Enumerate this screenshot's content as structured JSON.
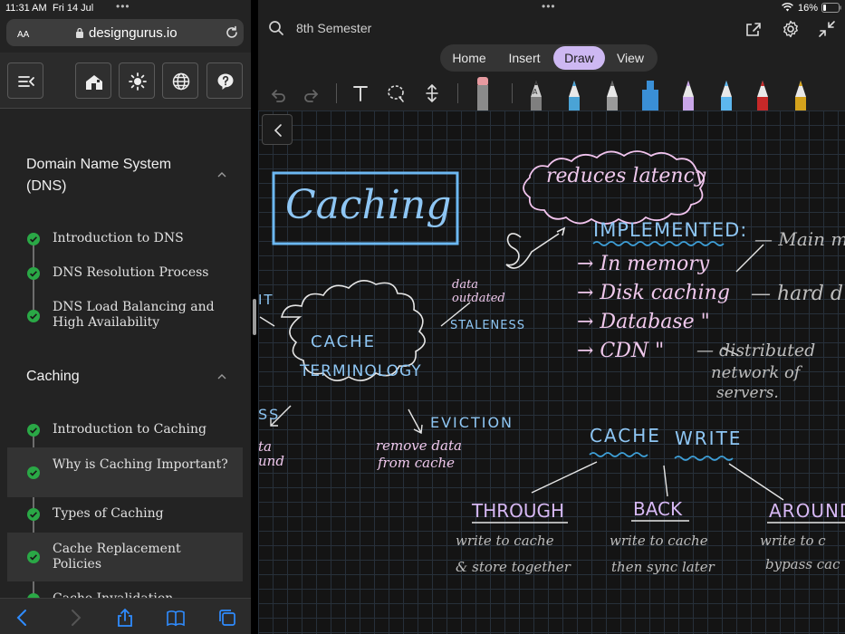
{
  "status_left": {
    "time": "11:31 AM",
    "date": "Fri 14 Jul"
  },
  "safari": {
    "text_size_label": "AA",
    "url": "designgurus.io"
  },
  "course": {
    "sections": [
      {
        "title": "Domain Name System (DNS)",
        "lessons": [
          "Introduction to DNS",
          "DNS Resolution Process",
          "DNS Load Balancing and High Availability"
        ]
      },
      {
        "title": "Caching",
        "lessons": [
          "Introduction to Caching",
          "Why is Caching Important?",
          "Types of Caching",
          "Cache Replacement Policies",
          "Cache Invalidation"
        ]
      }
    ]
  },
  "status_right": {
    "battery": "16%"
  },
  "notes": {
    "document_title": "8th Semester",
    "tabs": [
      "Home",
      "Insert",
      "Draw",
      "View"
    ],
    "active_tab": "Draw"
  },
  "board": {
    "title": "Caching",
    "cloud_top": "reduces latency",
    "cloud_center_1": "CACHE",
    "cloud_center_2": "TERMINOLOGY",
    "implemented": "IMPLEMENTED:",
    "impl_items": [
      "→ In memory",
      "→ Disk caching",
      "→ Database  \"",
      "→ CDN    \""
    ],
    "main_mem": "— Main m",
    "hard_d": "— hard d",
    "distributed": "— distributed",
    "network_of": "network of",
    "servers": "servers.",
    "data_outdated_1": "data",
    "data_outdated_2": "outdated",
    "staleness": "STALENESS",
    "eviction": "EVICTION",
    "remove_1": "remove data",
    "remove_2": "from cache",
    "it_fragment": "IT",
    "ss_fragment": "SS",
    "ta_fragment": "ta",
    "und_fragment": "und",
    "cache_write_1": "CACHE",
    "cache_write_2": "WRITE",
    "through": "THROUGH",
    "back": "BACK",
    "around": "AROUND",
    "through_1": "write to cache",
    "through_2": "& store together",
    "back_1": "write to cache",
    "back_2": "then sync later",
    "around_1": "write to c",
    "around_2": "bypass cac"
  },
  "colors": {
    "active_tab": "#cdb8f2",
    "check_green": "#2aa846",
    "ink_blue": "#8ec6f4",
    "ink_pink": "#efc8ec",
    "ink_lavender": "#d6b8f4"
  },
  "icons": {
    "safari": [
      "lock-icon",
      "reload-icon"
    ],
    "left_toolbar": [
      "collapse-sidebar-icon",
      "home-icon",
      "theme-icon",
      "globe-icon",
      "help-icon"
    ],
    "bottom_bar": [
      "back-icon",
      "forward-icon",
      "share-icon",
      "bookmarks-icon",
      "tabs-icon"
    ],
    "notes_top": [
      "search-icon",
      "share-icon",
      "settings-icon",
      "collapse-icon"
    ],
    "draw_tools": [
      "undo-icon",
      "redo-icon",
      "text-icon",
      "lasso-icon",
      "insert-space-icon",
      "eraser-icon",
      "pencil-icon",
      "pen-icon",
      "marker-icon",
      "highlighter-icon"
    ]
  }
}
